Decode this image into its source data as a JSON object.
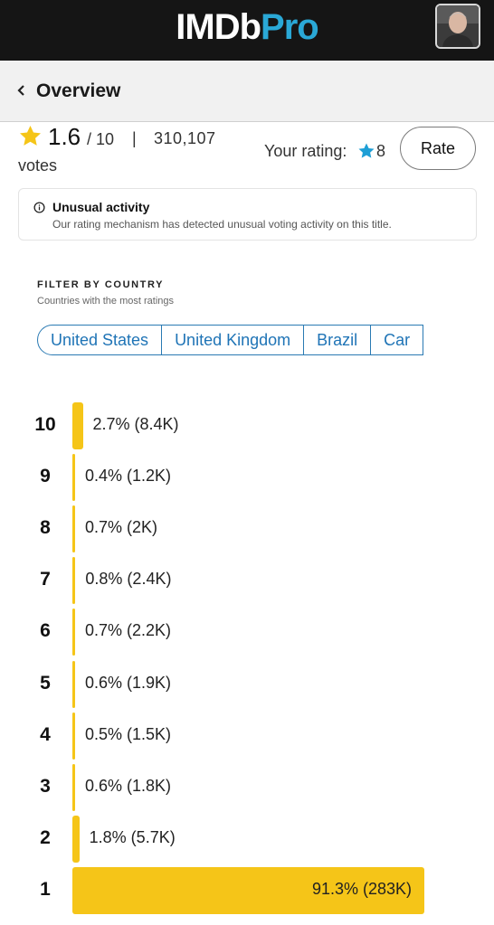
{
  "app": {
    "logo_main": "IMDb",
    "logo_accent": "Pro",
    "avatar_icon": "user-avatar"
  },
  "header": {
    "back_icon": "chevron-left-icon",
    "title": "Overview"
  },
  "rating": {
    "value": "1.6",
    "max": "/ 10",
    "separator": "|",
    "votes_count": "310,107",
    "votes_label": "votes",
    "your_rating_label": "Your rating:",
    "your_rating_value": "8",
    "rate_button_label": "Rate",
    "star_color": "#f5c518",
    "your_star_color": "#1e9fd6"
  },
  "notice": {
    "icon": "info-icon",
    "title": "Unusual activity",
    "text": "Our rating mechanism has detected unusual voting activity on this title."
  },
  "filter": {
    "heading": "FILTER BY COUNTRY",
    "subheading": "Countries with the most ratings",
    "countries": [
      "United States",
      "United Kingdom",
      "Brazil",
      "Car"
    ]
  },
  "histogram": {
    "bar_color": "#f5c518",
    "rows": [
      {
        "score": "10",
        "share": 0.027,
        "label": "2.7% (8.4K)"
      },
      {
        "score": "9",
        "share": 0.004,
        "label": "0.4% (1.2K)"
      },
      {
        "score": "8",
        "share": 0.007,
        "label": "0.7% (2K)"
      },
      {
        "score": "7",
        "share": 0.008,
        "label": "0.8% (2.4K)"
      },
      {
        "score": "6",
        "share": 0.007,
        "label": "0.7% (2.2K)"
      },
      {
        "score": "5",
        "share": 0.006,
        "label": "0.6% (1.9K)"
      },
      {
        "score": "4",
        "share": 0.005,
        "label": "0.5% (1.5K)"
      },
      {
        "score": "3",
        "share": 0.006,
        "label": "0.6% (1.8K)"
      },
      {
        "score": "2",
        "share": 0.018,
        "label": "1.8% (5.7K)"
      },
      {
        "score": "1",
        "share": 0.913,
        "label": "91.3% (283K)"
      }
    ]
  }
}
